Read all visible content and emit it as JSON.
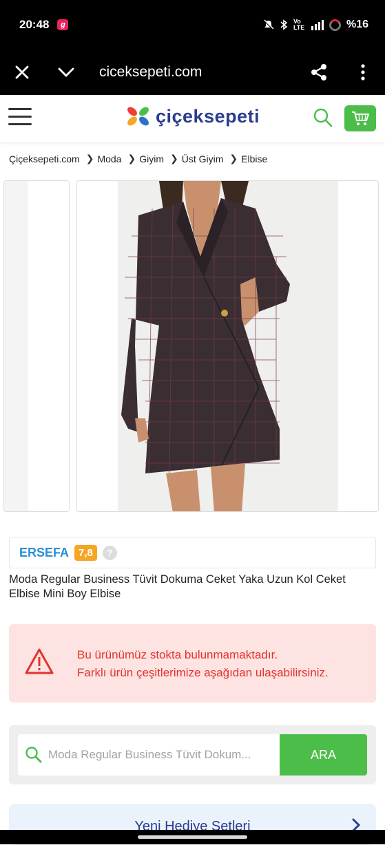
{
  "status_bar": {
    "time": "20:48",
    "app_badge": "g",
    "network": "Vo LTE",
    "battery": "%16"
  },
  "browser": {
    "url": "ciceksepeti.com"
  },
  "site": {
    "logo_text": "çiçeksepeti",
    "brand_color": "#2b3d8f",
    "accent_green": "#4dbd4a"
  },
  "breadcrumb": [
    "Çiçeksepeti.com",
    "Moda",
    "Giyim",
    "Üst Giyim",
    "Elbise"
  ],
  "seller": {
    "name": "ERSEFA",
    "score": "7,8",
    "help": "?"
  },
  "product": {
    "title": "Moda Regular Business Tüvit Dokuma Ceket Yaka Uzun Kol Ceket Elbise Mini Boy Elbise"
  },
  "alert": {
    "line1": "Bu ürünümüz stokta bulunmamaktadır.",
    "line2": "Farklı ürün çeşitlerimize aşağıdan ulaşabilirsiniz."
  },
  "search": {
    "placeholder": "Moda Regular Business Tüvit Dokum...",
    "button_label": "ARA"
  },
  "gift_banner": {
    "label": "Yeni Hediye Setleri"
  }
}
